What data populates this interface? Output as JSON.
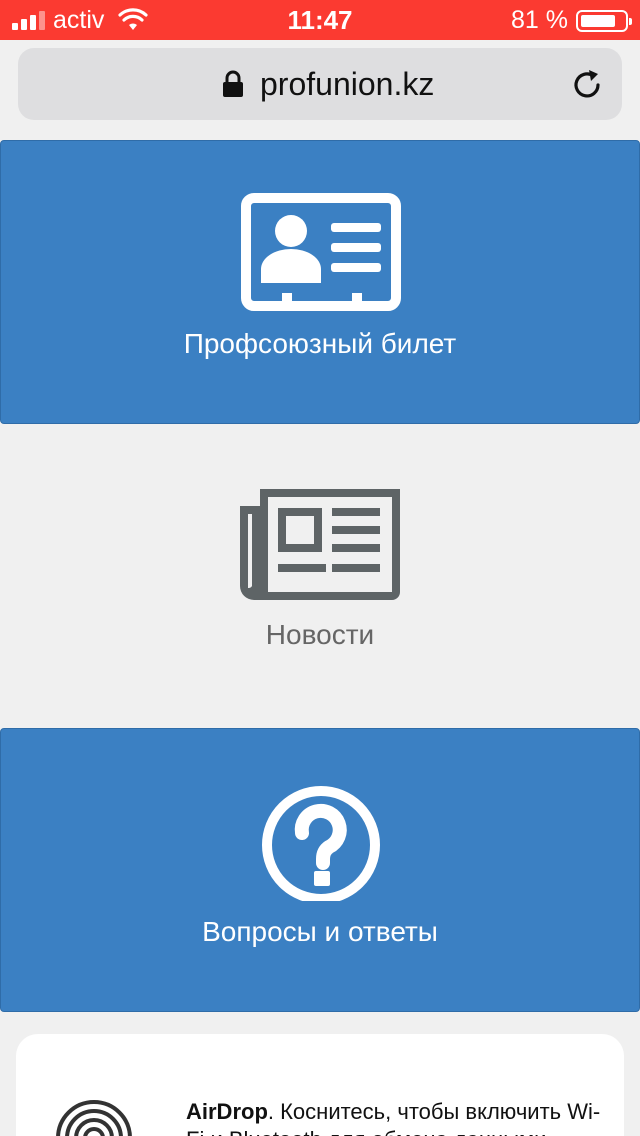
{
  "status_bar": {
    "carrier": "activ",
    "time": "11:47",
    "battery": "81 %",
    "battery_level": 0.81
  },
  "browser": {
    "url": "profunion.kz"
  },
  "menu": [
    {
      "label": "Профсоюзный билет",
      "icon": "id-card-icon"
    },
    {
      "label": "Новости",
      "icon": "newspaper-icon"
    },
    {
      "label": "Вопросы и ответы",
      "icon": "question-circle-icon"
    }
  ],
  "airdrop": {
    "title": "AirDrop",
    "text": ". Коснитесь, чтобы включить Wi-Fi и Bluetooth для обмена данными",
    "icon": "airdrop-icon"
  },
  "colors": {
    "status_bar": "#fb3a31",
    "tile_blue": "#3b80c3",
    "icon_gray": "#5e6466"
  }
}
